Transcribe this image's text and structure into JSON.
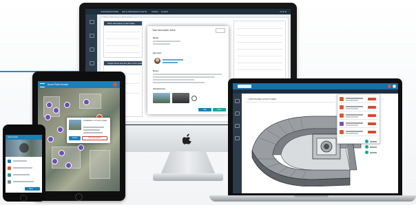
{
  "desktop": {
    "nav_tabs": [
      "CONSTRUCTIONS",
      "GIS & PROCESS PLANTS",
      "TASKS",
      "PLANS"
    ],
    "nav_right": "✉ ★ ⚙",
    "breadcrumb": "⌂  Task » Structures » Task detail",
    "left_pane_title": "Work description & plan tasks",
    "left_pane_lower_title": "Assignments and the plan of the works",
    "modal_title": "Task description detail",
    "modal_sections": [
      "Name",
      "Operator",
      "Notes",
      "Attachments"
    ],
    "modal_buttons": [
      "Edit",
      "Close"
    ]
  },
  "tablet": {
    "title": "Acme Plant Monitor",
    "popup_title": "Installation of control gate",
    "popup_buttons": [
      "Detail",
      "Open Navigation"
    ]
  },
  "phone": {
    "title": "Task Detail",
    "button": "Save"
  },
  "laptop": {
    "pane_title": "⌂  MONITORED STRUCTURES",
    "panel_rows": 5,
    "tools": 3
  },
  "colors": {
    "accent": "#1b8fc9",
    "header": "#1b7fb8",
    "dark_nav": "#1f2f3e",
    "sidebar": "#2d3c4b",
    "alert": "#e0552d",
    "success": "#1aa39a"
  }
}
